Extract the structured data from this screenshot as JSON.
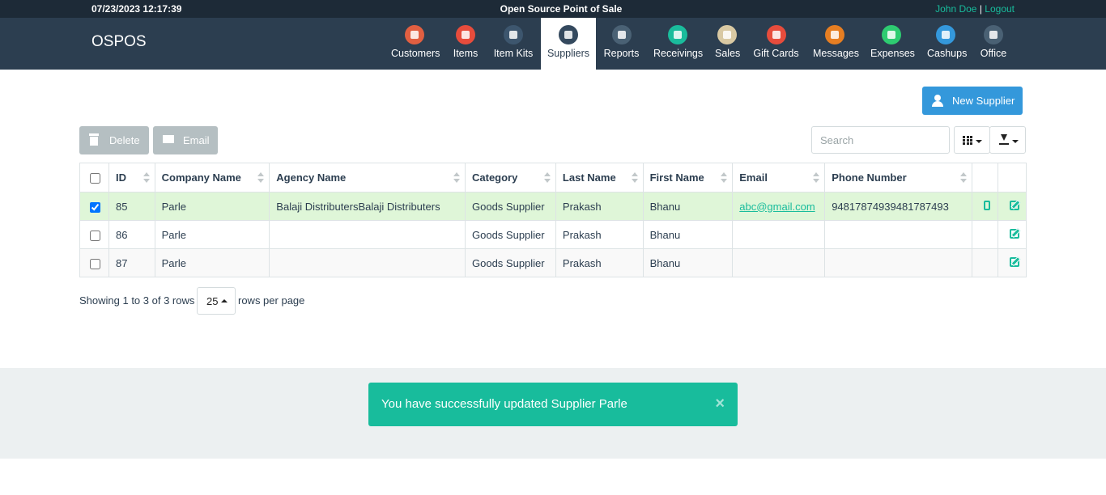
{
  "topbar": {
    "datetime": "07/23/2023 12:17:39",
    "title": "Open Source Point of Sale",
    "user": "John Doe",
    "separator": "|",
    "logout": "Logout"
  },
  "brand": "OSPOS",
  "nav": [
    {
      "label": "Customers",
      "icon": "customers-icon",
      "color": "#e15f41"
    },
    {
      "label": "Items",
      "icon": "items-icon",
      "color": "#e74c3c"
    },
    {
      "label": "Item Kits",
      "icon": "item-kits-icon",
      "color": "#3d566e"
    },
    {
      "label": "Suppliers",
      "icon": "suppliers-icon",
      "color": "#34495e",
      "active": true
    },
    {
      "label": "Reports",
      "icon": "reports-icon",
      "color": "#4a6174"
    },
    {
      "label": "Receivings",
      "icon": "receivings-icon",
      "color": "#1abc9c"
    },
    {
      "label": "Sales",
      "icon": "sales-icon",
      "color": "#d9c9a3"
    },
    {
      "label": "Gift Cards",
      "icon": "gift-cards-icon",
      "color": "#e74c3c"
    },
    {
      "label": "Messages",
      "icon": "messages-icon",
      "color": "#e67e22"
    },
    {
      "label": "Expenses",
      "icon": "expenses-icon",
      "color": "#2ecc71"
    },
    {
      "label": "Cashups",
      "icon": "cashups-icon",
      "color": "#3498db"
    },
    {
      "label": "Office",
      "icon": "office-icon",
      "color": "#4a6174"
    }
  ],
  "toolbar": {
    "new_supplier": "New Supplier",
    "delete": "Delete",
    "email": "Email",
    "search_placeholder": "Search"
  },
  "table": {
    "columns": [
      "ID",
      "Company Name",
      "Agency Name",
      "Category",
      "Last Name",
      "First Name",
      "Email",
      "Phone Number"
    ],
    "rows": [
      {
        "id": "85",
        "company": "Parle",
        "agency": "Balaji DistributersBalaji Distributers",
        "category": "Goods Supplier",
        "last": "Prakash",
        "first": "Bhanu",
        "email": "abc@gmail.com",
        "phone": "94817874939481787493",
        "has_phone_icon": true
      },
      {
        "id": "86",
        "company": "Parle",
        "agency": "",
        "category": "Goods Supplier",
        "last": "Prakash",
        "first": "Bhanu",
        "email": "",
        "phone": "",
        "has_phone_icon": false
      },
      {
        "id": "87",
        "company": "Parle",
        "agency": "",
        "category": "Goods Supplier",
        "last": "Prakash",
        "first": "Bhanu",
        "email": "",
        "phone": "",
        "has_phone_icon": false
      }
    ]
  },
  "pagination": {
    "info": "Showing 1 to 3 of 3 rows",
    "page_size": "25",
    "after": "rows per page"
  },
  "toast": {
    "message": "You have successfully updated Supplier Parle",
    "close": "×"
  },
  "colors": {
    "navbar": "#2c3e50",
    "accent": "#18bc9c",
    "primary": "#3498db",
    "selected_row": "#dff6d8"
  }
}
